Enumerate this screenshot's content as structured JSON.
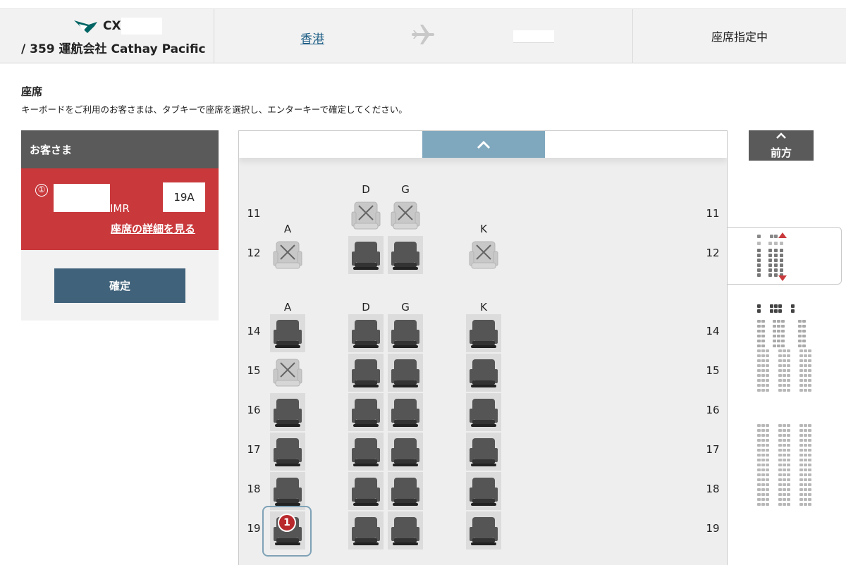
{
  "header": {
    "flight_code": "CX",
    "flight_line": "/ 359 運航会社 Cathay Pacific",
    "origin": "香港",
    "status": "座席指定中",
    "brand_color": "#006564"
  },
  "section": {
    "title": "座席",
    "hint": "キーボードをご利用のお客さまは、タブキーで座席を選択し、エンターキーで確定してください。"
  },
  "passengers": {
    "header": "お客さま",
    "items": [
      {
        "number": "①",
        "type": "IMR",
        "seat": "19A",
        "detail_link": "座席の詳細を見る"
      }
    ],
    "confirm_label": "確定"
  },
  "nav": {
    "front_label": "前方",
    "up_icon": "chevron-up-icon"
  },
  "seatmap": {
    "cols_top": [
      "D",
      "G"
    ],
    "cols_row12": [
      "A",
      "K"
    ],
    "cols_row14": [
      "A",
      "D",
      "G",
      "K"
    ],
    "rows": [
      {
        "label": "11",
        "seats": {
          "D": "occupied",
          "G": "occupied"
        }
      },
      {
        "label": "12",
        "seats": {
          "A": "occupied",
          "D": "available",
          "G": "available",
          "K": "occupied"
        }
      },
      {
        "label": "14",
        "seats": {
          "A": "available",
          "D": "available",
          "G": "available",
          "K": "available"
        }
      },
      {
        "label": "15",
        "seats": {
          "A": "occupied",
          "D": "available",
          "G": "available",
          "K": "available"
        }
      },
      {
        "label": "16",
        "seats": {
          "A": "available",
          "D": "available",
          "G": "available",
          "K": "available"
        }
      },
      {
        "label": "17",
        "seats": {
          "A": "available",
          "D": "available",
          "G": "available",
          "K": "available"
        }
      },
      {
        "label": "18",
        "seats": {
          "A": "available",
          "D": "available",
          "G": "available",
          "K": "available"
        }
      },
      {
        "label": "19",
        "seats": {
          "A": "selected",
          "D": "available",
          "G": "available",
          "K": "available"
        }
      }
    ],
    "selected_badge": "1",
    "colors": {
      "available": "#555555",
      "occupied": "#c8c8c8",
      "selected_frame": "#7fa2b6",
      "badge": "#b9282c"
    }
  }
}
